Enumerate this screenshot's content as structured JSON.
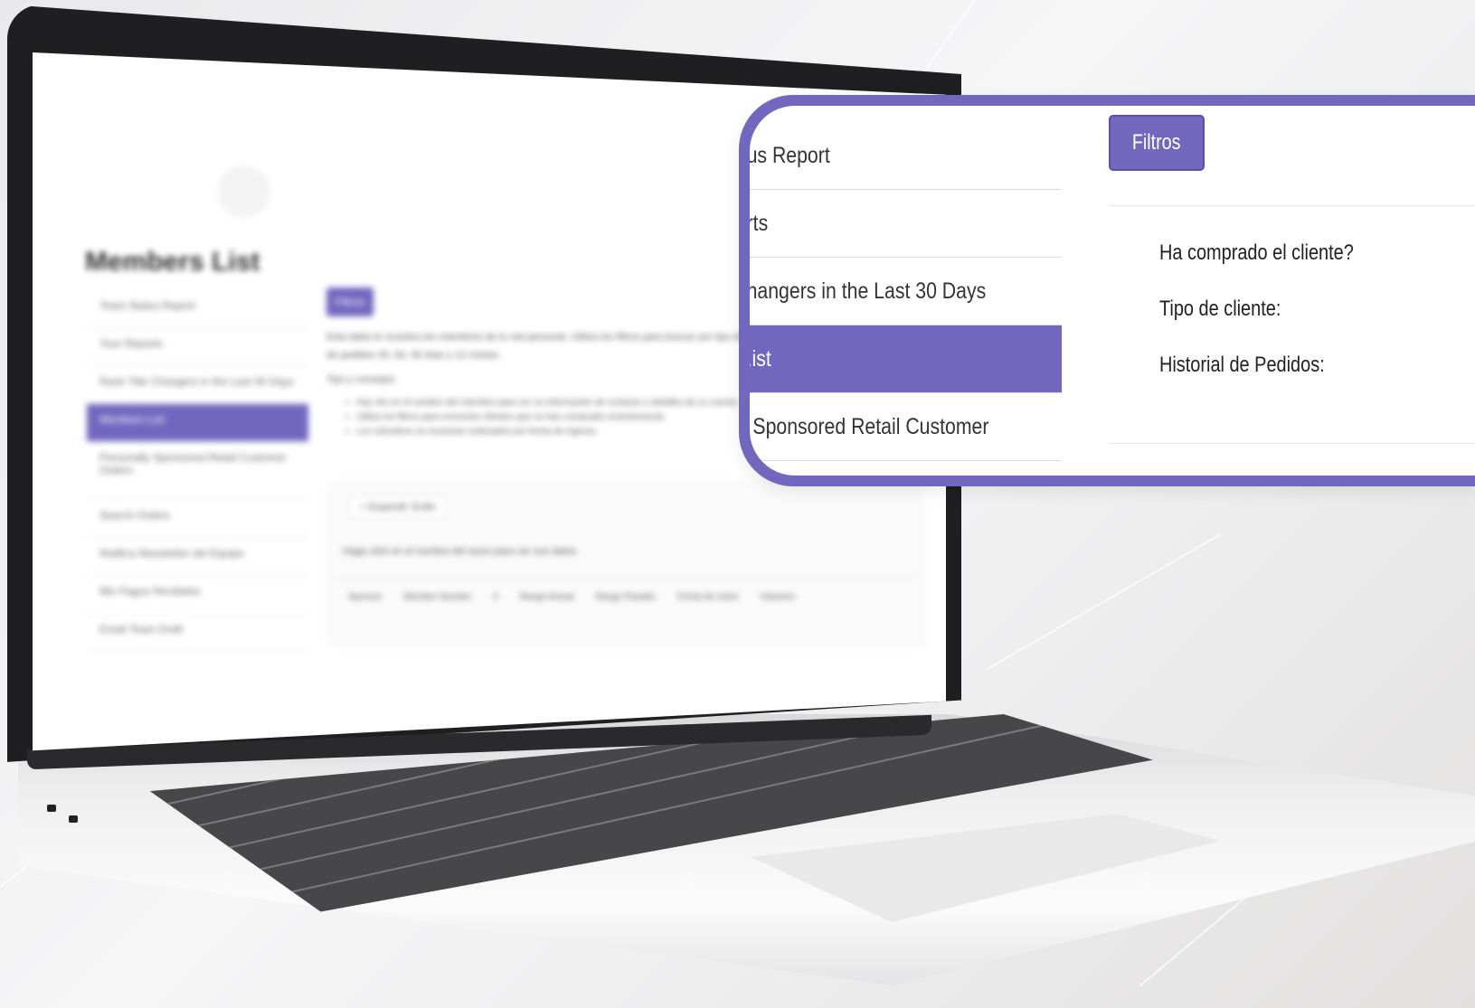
{
  "background_screen": {
    "page_title": "Members List",
    "sidebar_items": [
      "Team Status Report",
      "Your Reports",
      "Rank Title Changers in the Last 30 Days",
      "Members List",
      "Personally Sponsored Retail Customer Orders",
      "Search Orders",
      "Notifica Newsletter del Equipo",
      "Mis Pagos Recibidos",
      "Email Team Draft"
    ],
    "active_sidebar_index": 3,
    "filter_button": "Filtros",
    "paragraph": "Esta tabla te muestra los miembros de tu red personal. Utiliza los filtros para buscar por tipo de cliente, fecha de compra o historial de pedidos 30, 60, 90 días o 12 meses.",
    "tips_heading": "Tips y consejos",
    "bullets": [
      "Haz clic en el nombre del miembro para ver su información de contacto y detalles de su cuenta.",
      "Utiliza los filtros para encontrar clientes que no han comprado recientemente.",
      "Los miembros se muestran ordenados por fecha de ingreso."
    ],
    "table_toggle": "+ Expandir Grafo",
    "table_note": "Haga click en el nombre del socio para ver sus datos",
    "table_headers": [
      "Sponsor",
      "Member Number",
      "#",
      "Rango Actual",
      "Rango Pasado",
      "Fecha de Inicio",
      "Volumen"
    ]
  },
  "zoom": {
    "menu_items": [
      {
        "label": "us Report",
        "active": false
      },
      {
        "label": "rts",
        "active": false
      },
      {
        "label": "hangers in the Last 30 Days",
        "active": false
      },
      {
        "label": ".ist",
        "active": true
      },
      {
        "label": "Sponsored Retail Customer",
        "active": false
      }
    ],
    "filter_button": "Filtros",
    "filter_fields": [
      "Ha comprado el cliente?",
      "Tipo de cliente:",
      "Historial de Pedidos:"
    ]
  },
  "colors": {
    "accent": "#7267bf",
    "laptop_body": "#1f1f22",
    "keyboard": "#474749"
  }
}
